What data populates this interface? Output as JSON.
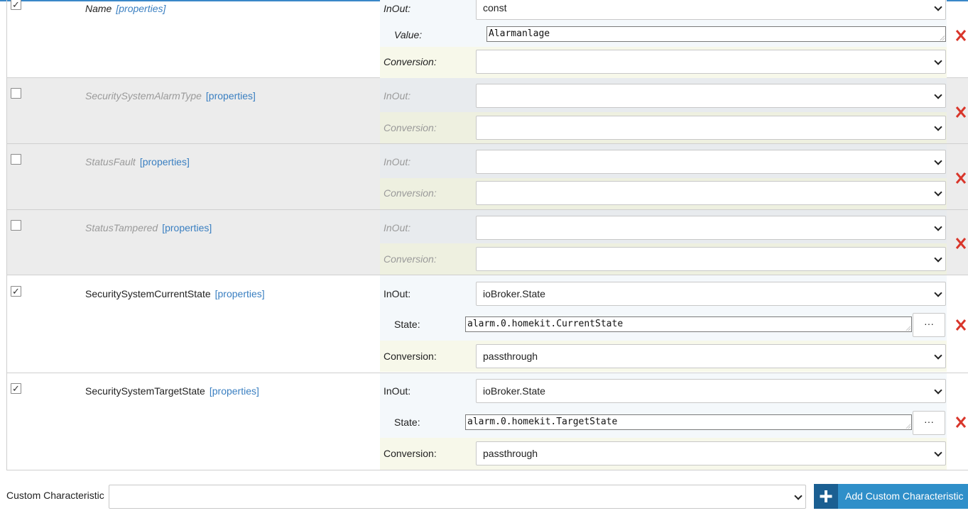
{
  "characteristics": [
    {
      "name": "Name",
      "properties_link": "[properties]",
      "checked": true,
      "inout_label": "InOut:",
      "inout_value": "const",
      "sub_label": "Value:",
      "sub_value": "Alarmanlage",
      "conversion_label": "Conversion:",
      "conversion_value": ""
    },
    {
      "name": "SecuritySystemAlarmType",
      "properties_link": "[properties]",
      "checked": false,
      "inout_label": "InOut:",
      "inout_value": "",
      "conversion_label": "Conversion:",
      "conversion_value": ""
    },
    {
      "name": "StatusFault",
      "properties_link": "[properties]",
      "checked": false,
      "inout_label": "InOut:",
      "inout_value": "",
      "conversion_label": "Conversion:",
      "conversion_value": ""
    },
    {
      "name": "StatusTampered",
      "properties_link": "[properties]",
      "checked": false,
      "inout_label": "InOut:",
      "inout_value": "",
      "conversion_label": "Conversion:",
      "conversion_value": ""
    },
    {
      "name": "SecuritySystemCurrentState",
      "properties_link": "[properties]",
      "checked": true,
      "inout_label": "InOut:",
      "inout_value": "ioBroker.State",
      "sub_label": "State:",
      "sub_value": "alarm.0.homekit.CurrentState",
      "browse_label": "···",
      "conversion_label": "Conversion:",
      "conversion_value": "passthrough"
    },
    {
      "name": "SecuritySystemTargetState",
      "properties_link": "[properties]",
      "checked": true,
      "inout_label": "InOut:",
      "inout_value": "ioBroker.State",
      "sub_label": "State:",
      "sub_value": "alarm.0.homekit.TargetState",
      "browse_label": "···",
      "conversion_label": "Conversion:",
      "conversion_value": "passthrough"
    }
  ],
  "custom": {
    "label": "Custom Characteristic",
    "select_value": "",
    "add_button_label": "Add Custom Characteristic"
  },
  "icons": {
    "delete": "delete-x-icon",
    "plus": "plus-icon",
    "check": "checkmark-icon",
    "chevron": "chevron-down-icon"
  },
  "colors": {
    "accent": "#2f8fc9",
    "accent_dark": "#1b5f92",
    "link": "#3a7fc1",
    "delete": "#d9362b",
    "inout_bg": "#f4f8fb",
    "conversion_bg": "#f7f8ea",
    "disabled_bg": "#ececec"
  }
}
